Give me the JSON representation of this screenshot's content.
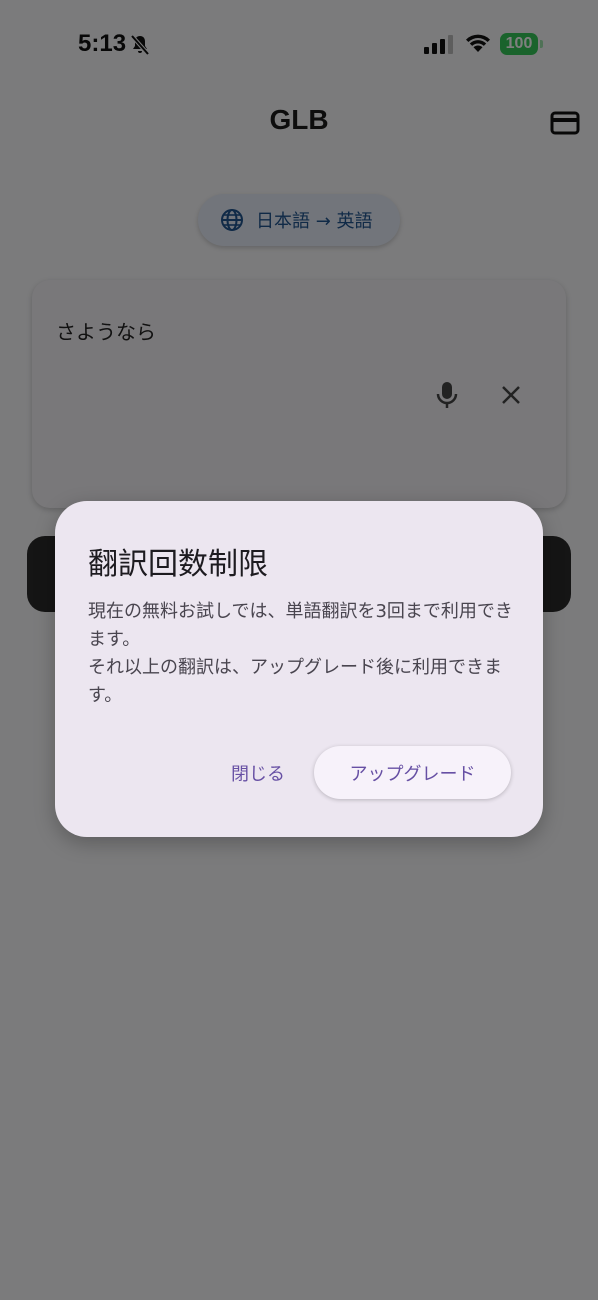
{
  "status_bar": {
    "time": "5:13",
    "battery_level": "100",
    "battery_color": "#34c759"
  },
  "app_bar": {
    "title": "GLB",
    "subscription_icon": "credit-card-icon"
  },
  "language_selector": {
    "icon": "globe-icon",
    "label": "日本語 → 英語"
  },
  "input": {
    "text": "さようなら",
    "mic_icon": "mic-icon",
    "clear_icon": "close-icon"
  },
  "dialog": {
    "title": "翻訳回数制限",
    "body_line1": "現在の無料お試しでは、単語翻訳を3回まで利用できます。",
    "body_line2": "それ以上の翻訳は、アップグレード後に利用できます。",
    "close_label": "閉じる",
    "upgrade_label": "アップグレード",
    "accent_color": "#6750a4"
  }
}
